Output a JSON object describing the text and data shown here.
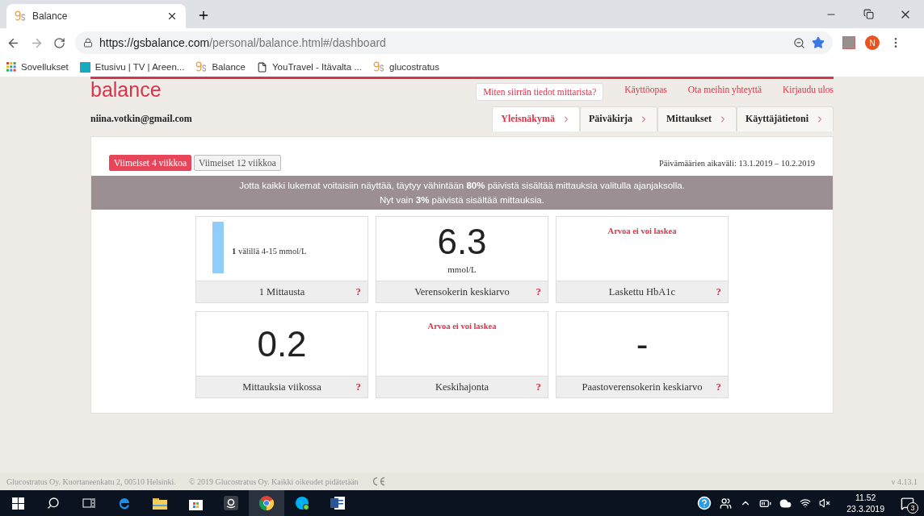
{
  "browser": {
    "tab": {
      "title": "Balance"
    },
    "url": {
      "host": "https://gsbalance.com",
      "path": "/personal/balance.html#/dashboard"
    },
    "bookmarks": [
      {
        "kind": "apps",
        "label": "Sovellukset"
      },
      {
        "kind": "yle",
        "label": "Etusivu | TV | Areen..."
      },
      {
        "kind": "gs",
        "label": "Balance"
      },
      {
        "kind": "file",
        "label": "YouTravel - Itävalta ..."
      },
      {
        "kind": "gs",
        "label": "glucostratus"
      }
    ],
    "avatar": "N"
  },
  "header": {
    "logo": "balance",
    "help_button": "Miten siirrän tiedot mittarista?",
    "links": [
      "Käyttöopas",
      "Ota meihin yhteyttä",
      "Kirjaudu ulos"
    ],
    "email": "niina.votkin@gmail.com",
    "nav": [
      {
        "label": "Yleisnäkymä",
        "selected": true
      },
      {
        "label": "Päiväkirja",
        "selected": false
      },
      {
        "label": "Mittaukset",
        "selected": false
      },
      {
        "label": "Käyttäjätietoni",
        "selected": false
      }
    ]
  },
  "period_buttons": [
    {
      "label": "Viimeiset 4 viikkoa",
      "selected": true
    },
    {
      "label": "Viimeiset 12 viikkoa",
      "selected": false
    }
  ],
  "date_range": "Päivämäärien aikaväli: 13.1.2019 – 10.2.2019",
  "notice": [
    "Jotta kaikki lukemat voitaisiin näyttää, täytyy vähintään **80%** päivistä sisältää mittauksia valitulla ajanjaksolla.",
    "Nyt vain **3%** päivistä sisältää mittauksia."
  ],
  "cards": [
    {
      "kind": "range",
      "count": "1",
      "text": "välillä 4-15 mmol/L",
      "label": "1 Mittausta",
      "help": "?"
    },
    {
      "kind": "value",
      "value": "6.3",
      "unit": "mmol/L",
      "label": "Verensokerin keskiarvo",
      "help": "?"
    },
    {
      "kind": "error",
      "message": "Arvoa ei voi laskea",
      "label": "Laskettu HbA1c",
      "help": "?"
    },
    {
      "kind": "value",
      "value": "0.2",
      "label": "Mittauksia viikossa",
      "help": "?"
    },
    {
      "kind": "error",
      "message": "Arvoa ei voi laskea",
      "label": "Keskihajonta",
      "help": "?"
    },
    {
      "kind": "value",
      "value": "-",
      "label": "Paastoverensokerin keskiarvo",
      "help": "?"
    }
  ],
  "footer": {
    "address": "Glucostratus Oy. Kuortaneenkatu 2, 00510 Helsinki.",
    "copyright": "© 2019 Glucostratus Oy. Kaikki oikeudet pidätetään",
    "version": "v 4.13.1"
  },
  "taskbar": {
    "time": "11.52",
    "date": "23.3.2019",
    "notifications": "3"
  }
}
